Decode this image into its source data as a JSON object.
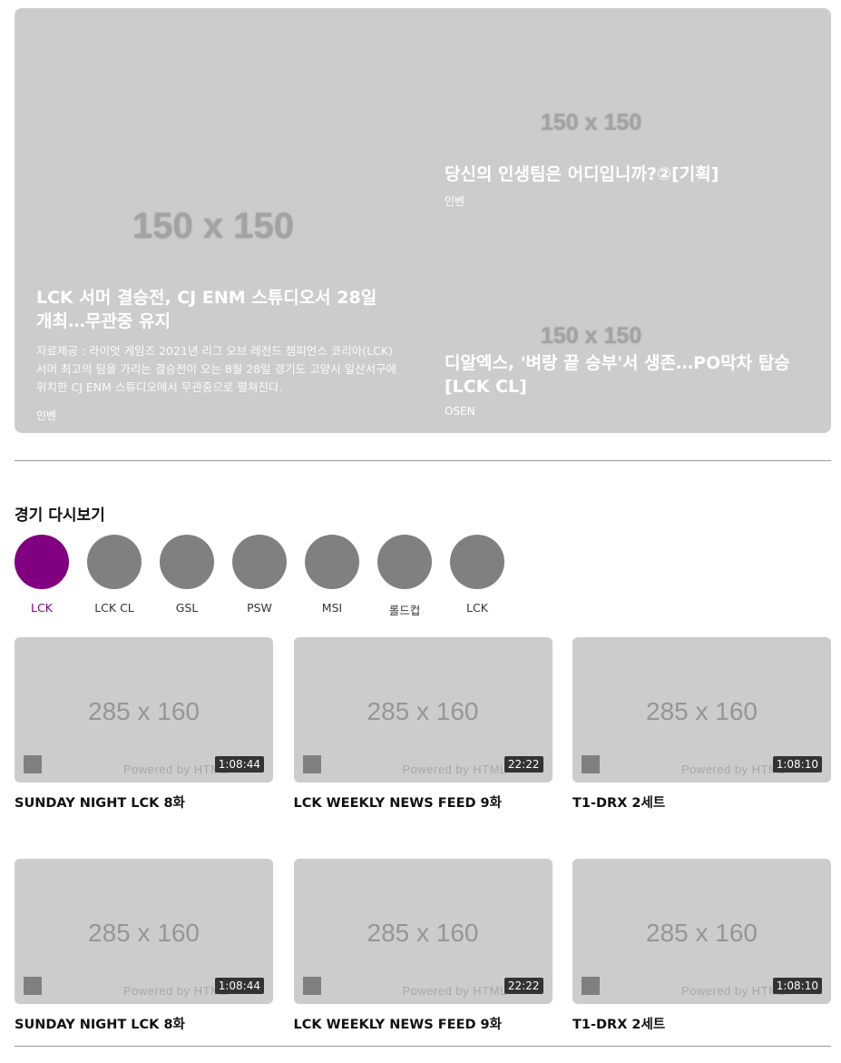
{
  "hero": {
    "placeholder_main": "150 x 150",
    "main": {
      "title": "LCK 서머 결승전, CJ ENM 스튜디오서 28일 개최…무관중 유지",
      "description": "자료제공 : 라이엇 게임즈 2021년 리그 오브 레전드 챔피언스 코리아(LCK) 서머 최고의 팀을 가리는 결승전이 오는 8월 28일 경기도 고양시 일산서구에 위치한 CJ ENM 스튜디오에서 무관중으로 펼쳐진다.",
      "source": "인벤"
    },
    "side": [
      {
        "placeholder": "150 x 150",
        "title": "당신의 인생팀은 어디입니까?②[기획]",
        "source": "인벤"
      },
      {
        "placeholder": "150 x 150",
        "title": "디알엑스, '벼랑 끝 승부'서 생존…PO막차 탑승[LCK CL]",
        "source": "OSEN"
      }
    ]
  },
  "replay": {
    "title": "경기 다시보기",
    "leagues": [
      {
        "label": "LCK",
        "active": true,
        "color": "#800080"
      },
      {
        "label": "LCK CL",
        "active": false,
        "color": "#808080"
      },
      {
        "label": "GSL",
        "active": false,
        "color": "#808080"
      },
      {
        "label": "PSW",
        "active": false,
        "color": "#808080"
      },
      {
        "label": "MSI",
        "active": false,
        "color": "#808080"
      },
      {
        "label": "롤드컵",
        "active": false,
        "color": "#808080"
      },
      {
        "label": "LCK",
        "active": false,
        "color": "#808080"
      }
    ],
    "videos": [
      {
        "placeholder": "285 x 160",
        "powered": "Powered by HTML",
        "duration": "1:08:44",
        "title": "SUNDAY NIGHT LCK 8화"
      },
      {
        "placeholder": "285 x 160",
        "powered": "Powered by HTML",
        "duration": "22:22",
        "title": "LCK WEEKLY NEWS FEED 9화"
      },
      {
        "placeholder": "285 x 160",
        "powered": "Powered by HTML",
        "duration": "1:08:10",
        "title": "T1-DRX 2세트"
      },
      {
        "placeholder": "285 x 160",
        "powered": "Powered by HTML",
        "duration": "1:08:44",
        "title": "SUNDAY NIGHT LCK 8화"
      },
      {
        "placeholder": "285 x 160",
        "powered": "Powered by HTML",
        "duration": "22:22",
        "title": "LCK WEEKLY NEWS FEED 9화"
      },
      {
        "placeholder": "285 x 160",
        "powered": "Powered by HTML",
        "duration": "1:08:10",
        "title": "T1-DRX 2세트"
      }
    ]
  }
}
